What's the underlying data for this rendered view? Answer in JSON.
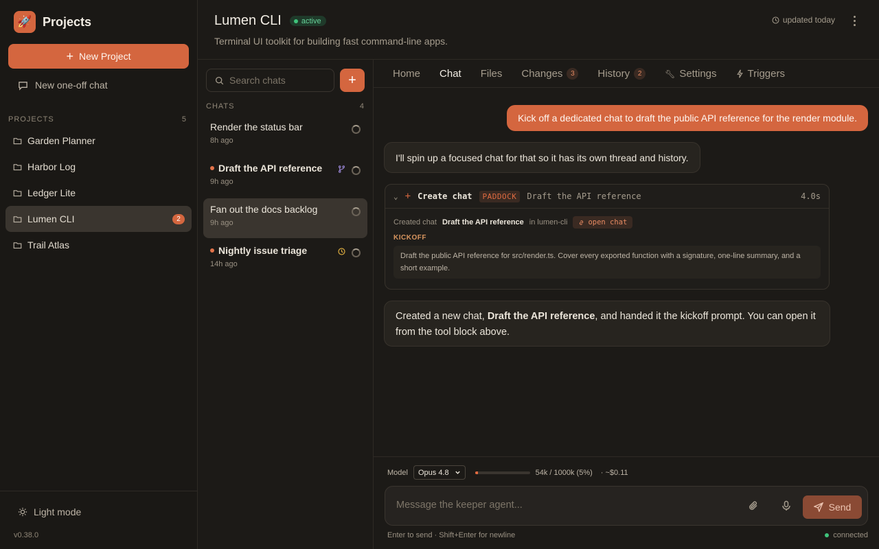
{
  "sidebar": {
    "brand_title": "Projects",
    "brand_icon": "rocket-icon",
    "new_project_label": "New Project",
    "oneoff_label": "New one-off chat",
    "projects_heading": "PROJECTS",
    "projects_count": "5",
    "projects": [
      {
        "name": "Garden Planner",
        "badge": ""
      },
      {
        "name": "Harbor Log",
        "badge": ""
      },
      {
        "name": "Ledger Lite",
        "badge": ""
      },
      {
        "name": "Lumen CLI",
        "badge": "2"
      },
      {
        "name": "Trail Atlas",
        "badge": ""
      }
    ],
    "active_project": "Lumen CLI",
    "light_mode_label": "Light mode",
    "version": "v0.38.0"
  },
  "header": {
    "title": "Lumen CLI",
    "status": "active",
    "subtitle": "Terminal UI toolkit for building fast command-line apps.",
    "updated": "updated today"
  },
  "chats": {
    "search_placeholder": "Search chats",
    "heading": "CHATS",
    "count": "4",
    "items": [
      {
        "title": "Render the status bar",
        "time": "8h ago",
        "unread": false
      },
      {
        "title": "Draft the API reference",
        "time": "9h ago",
        "unread": true
      },
      {
        "title": "Fan out the docs backlog",
        "time": "9h ago",
        "unread": false
      },
      {
        "title": "Nightly issue triage",
        "time": "14h ago",
        "unread": true
      }
    ],
    "active_chat": "Fan out the docs backlog"
  },
  "tabs": [
    {
      "label": "Home",
      "count": ""
    },
    {
      "label": "Chat",
      "count": ""
    },
    {
      "label": "Files",
      "count": ""
    },
    {
      "label": "Changes",
      "count": "3"
    },
    {
      "label": "History",
      "count": "2"
    },
    {
      "label": "Settings",
      "count": ""
    },
    {
      "label": "Triggers",
      "count": ""
    }
  ],
  "active_tab": "Chat",
  "conversation": {
    "user_message": "Kick off a dedicated chat to draft the public API reference for the render module.",
    "assistant_message_1": "I'll spin up a focused chat for that so it has its own thread and history.",
    "tool": {
      "name": "Create chat",
      "tag": "PADDOCK",
      "description": "Draft the API reference",
      "duration": "4.0s",
      "created_prefix": "Created chat",
      "created_name": "Draft the API reference",
      "created_in": "in lumen-cli",
      "open_label": "open chat",
      "kickoff_label": "KICKOFF",
      "kickoff_text": "Draft the public API reference for src/render.ts. Cover every exported function with a signature, one-line summary, and a short example."
    },
    "assistant_message_2_pre": "Created a new chat, ",
    "assistant_message_2_bold": "Draft the API reference",
    "assistant_message_2_post": ", and handed it the kickoff prompt. You can open it from the tool block above."
  },
  "composer": {
    "model_label": "Model",
    "model_value": "Opus 4.8",
    "token_usage": "54k / 1000k (5%)",
    "token_fraction": 0.05,
    "cost": "· ~$0.11",
    "placeholder": "Message the keeper agent...",
    "send_label": "Send",
    "hint": "Enter to send · Shift+Enter for newline",
    "connection": "connected"
  },
  "colors": {
    "accent": "#d4663f",
    "background": "#1c1a17",
    "status_green": "#3fc37b"
  }
}
